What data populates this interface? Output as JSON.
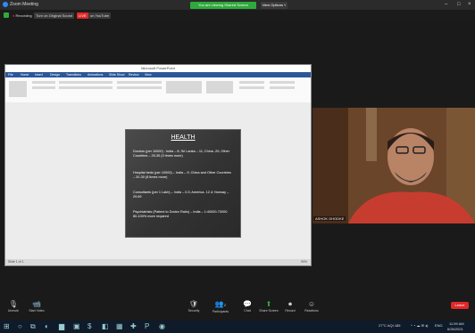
{
  "window": {
    "title": "Zoom Meeting",
    "minimize": "–",
    "maximize": "□",
    "close": "×"
  },
  "banner": {
    "text": "You are viewing Shared Screen",
    "view_options": "View Options ˅"
  },
  "zoom_bar": {
    "recording": "Recording",
    "original_sound": "Turn on Original Sound",
    "live": "LIVE",
    "live_target": "on YouTube"
  },
  "powerpoint": {
    "title": "Microsoft PowerPoint",
    "tabs": [
      "File",
      "Home",
      "Insert",
      "Design",
      "Transitions",
      "Animations",
      "Slide Show",
      "Review",
      "View"
    ],
    "status_left": "Slide 1 of 1",
    "status_right": "90%"
  },
  "slide": {
    "heading": "HEALTH",
    "paragraphs": [
      "Doctors (per 10000) : India – 8; Sri Lanka – 11; China -20; Other Countries – 25-35 (3 times more)",
      "Hospital beds (per 10000) – India – 9; China and Other Countries – 20-30 (8 times more)",
      "Consultants (per 1 Lakh) – India – 0.3; America- 12.4; Norway – 29.69",
      "Psychiatrists (Patient to Doctor Ratio) – India – 1:40000-70000.  80-100% more required"
    ]
  },
  "video": {
    "participant_name": "ASHOK GHODKE"
  },
  "toolbar": {
    "unmute": "Unmute",
    "start_video": "Start Video",
    "security": "Security",
    "participants": "Participants",
    "participants_count": "2",
    "chat": "Chat",
    "share_screen": "Share Screen",
    "record": "Record",
    "reactions": "Reactions",
    "leave": "Leave"
  },
  "taskbar": {
    "weather": "27°C  AQI 185",
    "lang": "ENG",
    "time": "11:59 AM",
    "date": "6/26/2021"
  },
  "colors": {
    "zoom_blue": "#2d8cff",
    "banner_green": "#2eaa3c",
    "leave_red": "#e02828",
    "ppt_blue": "#2b579a"
  }
}
